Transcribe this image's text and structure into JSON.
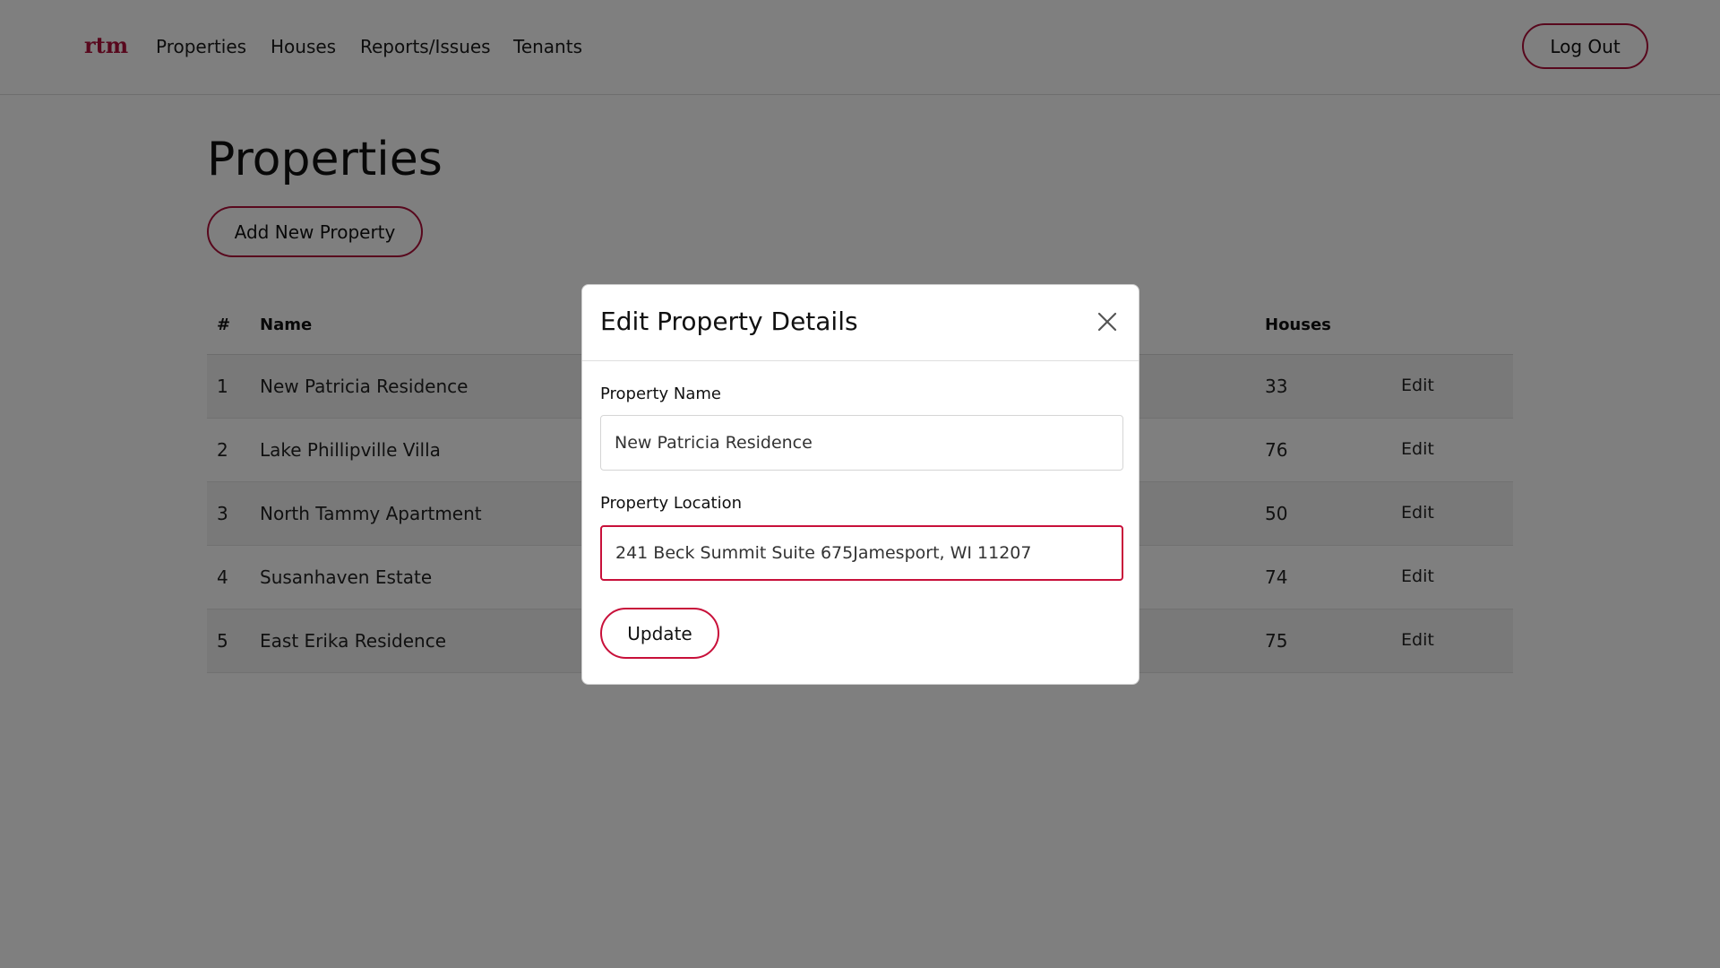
{
  "navbar": {
    "brand": "rtm",
    "links": [
      "Properties",
      "Houses",
      "Reports/Issues",
      "Tenants"
    ],
    "logout_label": "Log Out"
  },
  "main": {
    "title": "Properties",
    "add_button": "Add New Property",
    "table": {
      "headers": {
        "num": "#",
        "name": "Name",
        "houses": "Houses"
      },
      "rows": [
        {
          "num": "1",
          "name": "New Patricia Residence",
          "houses": "33",
          "action": "Edit"
        },
        {
          "num": "2",
          "name": "Lake Phillipville Villa",
          "houses": "76",
          "action": "Edit"
        },
        {
          "num": "3",
          "name": "North Tammy Apartment",
          "houses": "50",
          "action": "Edit"
        },
        {
          "num": "4",
          "name": "Susanhaven Estate",
          "houses": "74",
          "action": "Edit"
        },
        {
          "num": "5",
          "name": "East Erika Residence",
          "houses": "75",
          "action": "Edit"
        }
      ]
    }
  },
  "modal": {
    "title": "Edit Property Details",
    "name_label": "Property Name",
    "name_value": "New Patricia Residence",
    "location_label": "Property Location",
    "location_value": "241 Beck Summit Suite 675Jamesport, WI 11207",
    "update_label": "Update",
    "close_icon": "close-icon"
  },
  "colors": {
    "brand": "#b0103a",
    "overlay": "rgba(0,0,0,0.5)",
    "stripe": "#f2f2f2"
  }
}
